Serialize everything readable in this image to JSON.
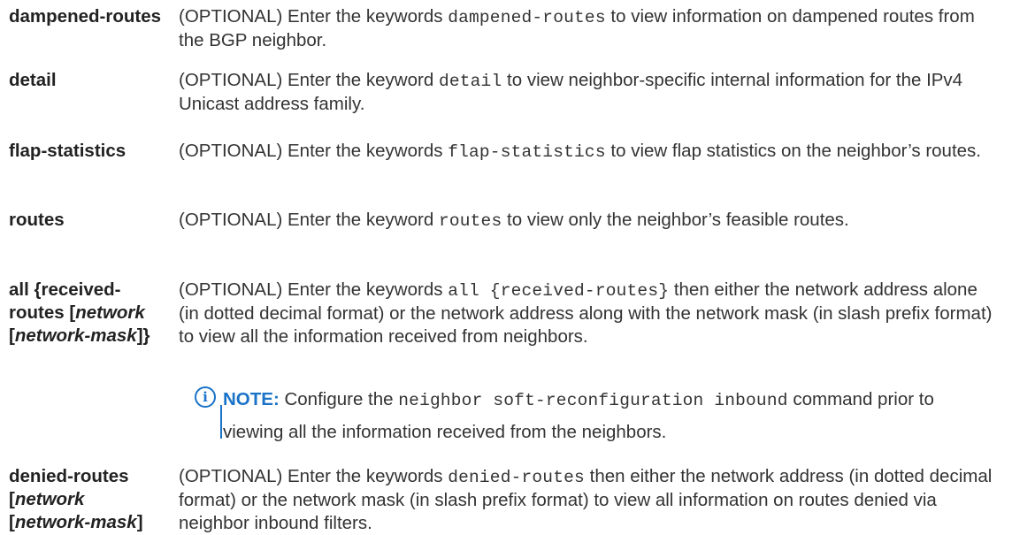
{
  "rows": [
    {
      "term": "dampened-routes",
      "pre": "(OPTIONAL) Enter the keywords ",
      "code": "dampened-routes",
      "post": " to view information on dampened routes from the BGP neighbor."
    },
    {
      "term": "detail",
      "pre": "(OPTIONAL) Enter the keyword ",
      "code": "detail",
      "post": " to view neighbor-specific internal information for the IPv4 Unicast address family."
    },
    {
      "term": "flap-statistics",
      "pre": "(OPTIONAL) Enter the keywords ",
      "code": "flap-statistics",
      "post": " to view flap statistics on the neighbor’s routes."
    },
    {
      "term": "routes",
      "pre": "(OPTIONAL) Enter the keyword ",
      "code": "routes",
      "post": " to view only the neighbor’s feasible routes."
    },
    {
      "term_a": "all {received-",
      "term_b": "routes [",
      "term_c": "network",
      "term_d": "[",
      "term_e": "network-mask",
      "term_f": "]}",
      "pre": "(OPTIONAL) Enter the keywords ",
      "code": "all {received-routes}",
      "post": " then either the network address alone (in dotted decimal format) or the network address along with the network mask (in slash prefix format) to view all the information received from neighbors.",
      "note": {
        "icon": "i",
        "label": "NOTE:",
        "pre": " Configure the ",
        "code": "neighbor soft-reconfiguration inbound",
        "post": " command prior to viewing all the information received from the neighbors."
      }
    },
    {
      "term_a": "denied-routes",
      "term_b": "[",
      "term_c": "network",
      "term_d": "[",
      "term_e": "network-mask",
      "term_f": "]",
      "pre": "(OPTIONAL) Enter the keywords ",
      "code": "denied-routes",
      "post": " then either the network address (in dotted decimal format) or the network mask (in slash prefix format) to view all information on routes denied via neighbor inbound filters."
    }
  ]
}
